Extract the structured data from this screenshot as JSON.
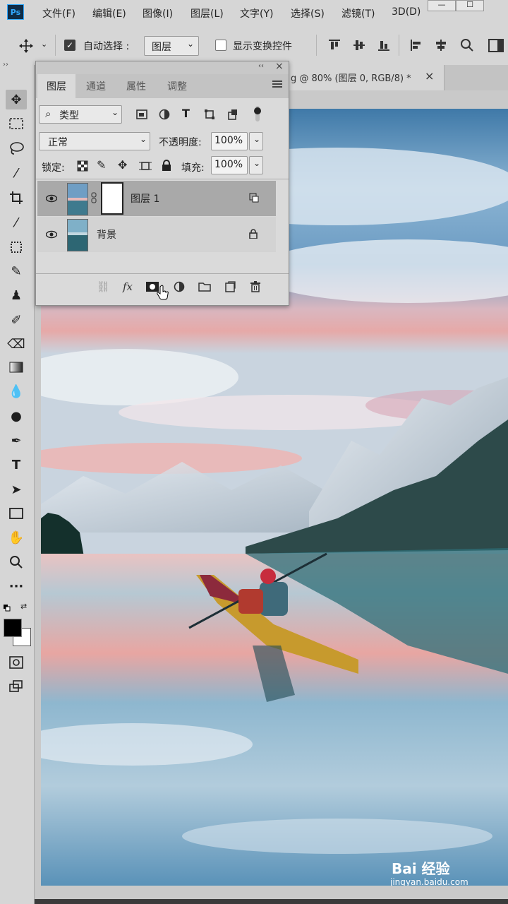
{
  "app": {
    "logo": "Ps"
  },
  "menu": [
    "文件(F)",
    "编辑(E)",
    "图像(I)",
    "图层(L)",
    "文字(Y)",
    "选择(S)",
    "滤镜(T)",
    "3D(D)"
  ],
  "window_controls": [
    "—",
    "☐"
  ],
  "options": {
    "auto_select_label": "自动选择 :",
    "auto_select_value": "图层",
    "auto_select_checked": true,
    "show_transform_label": "显示变换控件",
    "show_transform_checked": false
  },
  "document_tab": {
    "title": "g @ 80% (图层 0, RGB/8) *",
    "close": "×"
  },
  "panel": {
    "collapse_glyph": "‹‹",
    "close_glyph": "×",
    "tabs": [
      "图层",
      "通道",
      "属性",
      "调整"
    ],
    "active_tab": "图层",
    "filter_label": "类型",
    "blend_mode": "正常",
    "opacity_label": "不透明度:",
    "opacity_value": "100%",
    "lock_label": "锁定:",
    "fill_label": "填充:",
    "fill_value": "100%",
    "layers": [
      {
        "name": "图层 1",
        "selected": true,
        "has_mask": true,
        "lock": false
      },
      {
        "name": "背景",
        "selected": false,
        "has_mask": false,
        "lock": true
      }
    ],
    "bottom_icons": [
      "link-icon",
      "fx-icon",
      "add-mask-icon",
      "adjustment-icon",
      "group-folder-icon",
      "new-layer-icon",
      "trash-icon"
    ],
    "fx_label": "fx"
  },
  "tools": [
    "move",
    "marquee",
    "lasso",
    "magic-wand",
    "crop",
    "eyedropper",
    "frame",
    "brush",
    "stamp",
    "history-brush",
    "eraser",
    "gradient",
    "blur",
    "dodge",
    "pen",
    "type",
    "path-select",
    "rectangle",
    "hand",
    "zoom",
    "more"
  ],
  "colors": {
    "foreground": "#000000",
    "background": "#ffffff",
    "accent": "#31a8ff"
  },
  "watermark": {
    "brand": "Bai 经验",
    "url": "jingyan.baidu.com"
  }
}
